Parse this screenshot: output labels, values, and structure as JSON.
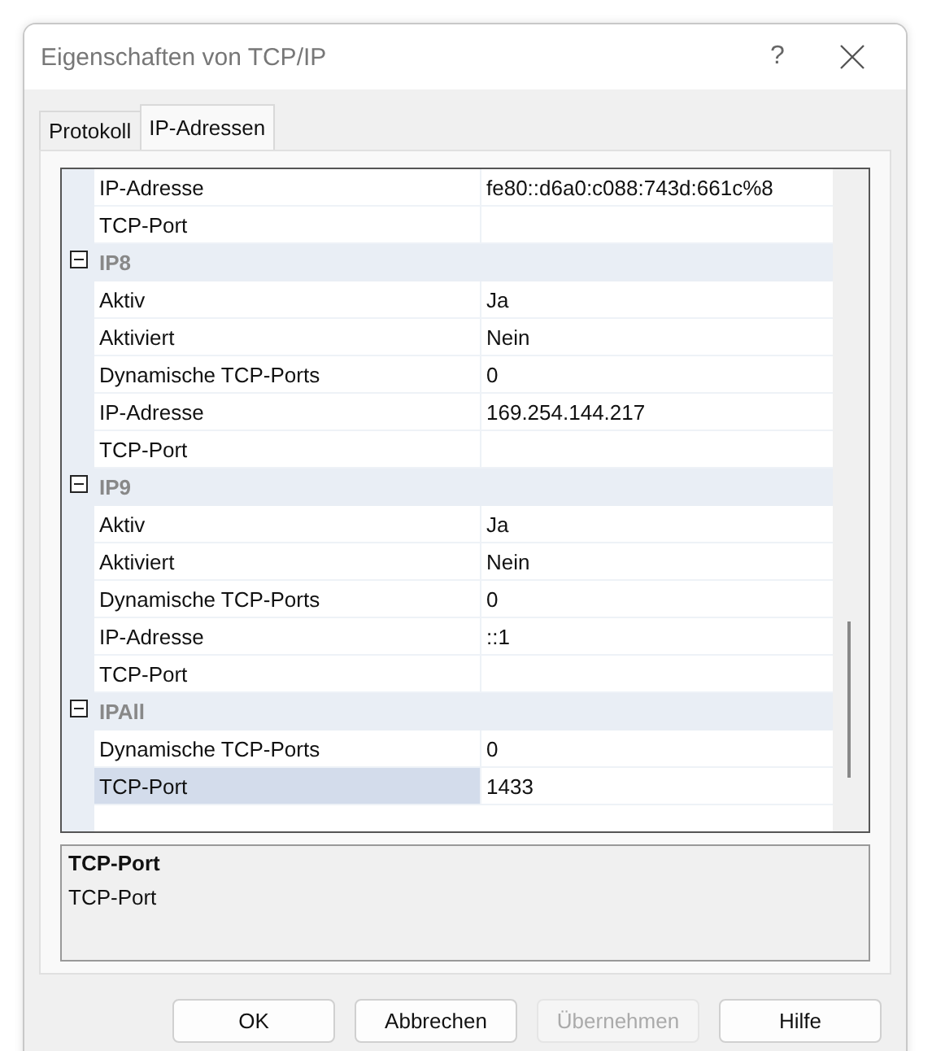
{
  "window": {
    "title": "Eigenschaften von TCP/IP",
    "help_glyph": "?"
  },
  "tabs": [
    {
      "label": "Protokoll",
      "selected": false
    },
    {
      "label": "IP-Adressen",
      "selected": true
    }
  ],
  "grid": {
    "rows": [
      {
        "kind": "property",
        "name": "IP-Adresse",
        "value": "fe80::d6a0:c088:743d:661c%8",
        "selected": false
      },
      {
        "kind": "property",
        "name": "TCP-Port",
        "selected": false
      },
      {
        "kind": "category",
        "name": "IP8",
        "expanded": true
      },
      {
        "kind": "property",
        "name": "Aktiv",
        "value": "Ja",
        "selected": false
      },
      {
        "kind": "property",
        "name": "Aktiviert",
        "value": "Nein",
        "selected": false
      },
      {
        "kind": "property",
        "name": "Dynamische TCP-Ports",
        "value": "0",
        "selected": false
      },
      {
        "kind": "property",
        "name": "IP-Adresse",
        "value": "169.254.144.217",
        "selected": false
      },
      {
        "kind": "property",
        "name": "TCP-Port",
        "selected": false
      },
      {
        "kind": "category",
        "name": "IP9",
        "expanded": true
      },
      {
        "kind": "property",
        "name": "Aktiv",
        "value": "Ja",
        "selected": false
      },
      {
        "kind": "property",
        "name": "Aktiviert",
        "value": "Nein",
        "selected": false
      },
      {
        "kind": "property",
        "name": "Dynamische TCP-Ports",
        "value": "0",
        "selected": false
      },
      {
        "kind": "property",
        "name": "IP-Adresse",
        "value": "::1",
        "selected": false
      },
      {
        "kind": "property",
        "name": "TCP-Port",
        "selected": false
      },
      {
        "kind": "category",
        "name": "IPAll",
        "expanded": true
      },
      {
        "kind": "property",
        "name": "Dynamische TCP-Ports",
        "value": "0",
        "selected": false
      },
      {
        "kind": "property",
        "name": "TCP-Port",
        "value": "1433",
        "selected": true
      }
    ]
  },
  "description": {
    "title": "TCP-Port",
    "text": "TCP-Port"
  },
  "buttons": [
    {
      "label": "OK",
      "disabled": false
    },
    {
      "label": "Abbrechen",
      "disabled": false
    },
    {
      "label": "Übernehmen",
      "disabled": true
    },
    {
      "label": "Hilfe",
      "disabled": false
    }
  ]
}
